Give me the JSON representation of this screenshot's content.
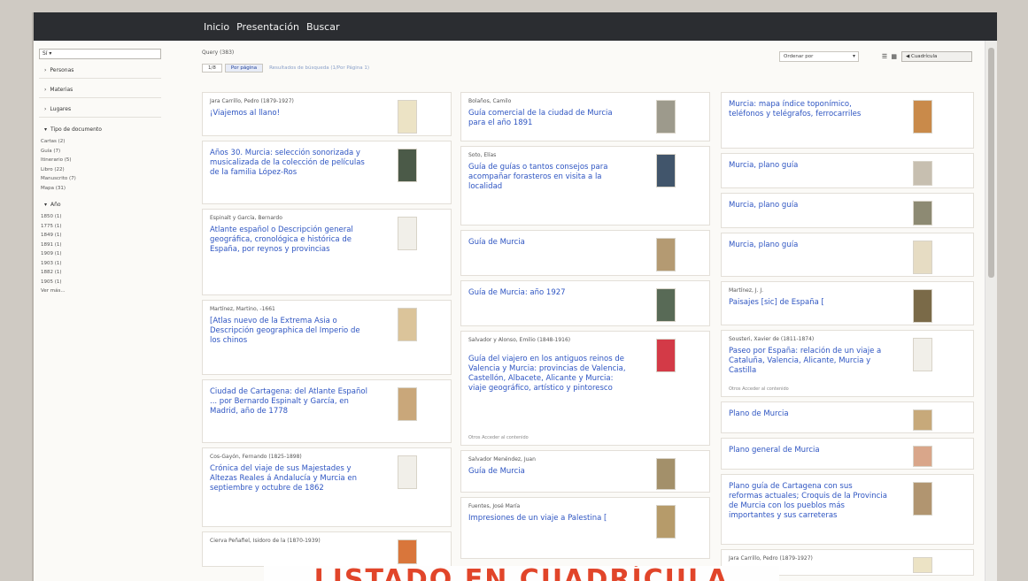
{
  "nav": {
    "items": [
      "Inicio",
      "Presentación",
      "Buscar"
    ]
  },
  "sidebar": {
    "select_value": "Sí ▾",
    "facets": [
      {
        "label": "Personas"
      },
      {
        "label": "Materias"
      },
      {
        "label": "Lugares"
      },
      {
        "label": "Tipo de documento",
        "items": [
          "Cartas (2)",
          "Guía (7)",
          "Itinerario (5)",
          "Libro (22)",
          "Manuscrito (7)",
          "Mapa (31)"
        ]
      },
      {
        "label": "Año",
        "items": [
          "1850 (1)",
          "1775 (1)",
          "1849 (1)",
          "1891 (1)",
          "1909 (1)",
          "1903 (1)",
          "1882 (1)",
          "1905 (1)",
          "Ver más..."
        ]
      }
    ]
  },
  "toolbar": {
    "query": "Query (383)",
    "pages": [
      "1/8",
      "Por página"
    ],
    "page_hint": "Resultados de búsqueda (1/Por Página 1)",
    "sort_label": "Ordenar por",
    "view_icons": "☰ ▦",
    "view_button": "◀ Cuadrícula"
  },
  "columns": [
    [
      {
        "author": "Jara Carrillo, Pedro (1879-1927)",
        "title": "¡Viajemos al llano!",
        "thumb": "#ece3c5",
        "h": 50
      },
      {
        "author": "",
        "title": "Años 30. Murcia: selección sonorizada y musicalizada de la colección de películas de la familia López-Ros",
        "thumb": "#4b5a48",
        "h": 72
      },
      {
        "author": "Espinalt y García, Bernardo",
        "title": "Atlante español o Descripción general geográfica, cronológica e histórica de España, por reynos y provincias",
        "thumb": "#f1efe9",
        "h": 98
      },
      {
        "author": "Martínez, Martino, -1661",
        "title": "[Atlas nuevo de la Extrema Asia o Descripción geographica del Imperio de los chinos",
        "thumb": "#dbc49a",
        "h": 85
      },
      {
        "author": "",
        "title": "Ciudad de Cartagena: del Atlante Español ... por Bernardo Espinalt y García, en Madrid, año de 1778",
        "thumb": "#c9a77a",
        "h": 72
      },
      {
        "author": "Cos-Gayón, Fernando (1825-1898)",
        "title": "Crónica del viaje de sus Majestades y Altezas Reales á Andalucía y Murcia en septiembre y octubre de 1862",
        "thumb": "#f1efe9",
        "h": 90
      },
      {
        "author": "Cierva Peñafiel, Isidoro de la (1870-1939)",
        "title": "",
        "thumb": "#d9763b",
        "h": 40
      }
    ],
    [
      {
        "author": "Bolaños, Camilo",
        "title": "Guía comercial de la ciudad de Murcia para el año 1891",
        "thumb": "#9d9a8c",
        "h": 56
      },
      {
        "author": "Soto, Elías",
        "title": "Guía de guías o tantos consejos para acompañar forasteros en visita a la localidad",
        "thumb": "#41556b",
        "h": 90
      },
      {
        "author": "",
        "title": "Guía de Murcia",
        "thumb": "#b49a72",
        "h": 52
      },
      {
        "author": "",
        "title": "Guía de Murcia: año 1927",
        "thumb": "#586a56",
        "h": 52
      },
      {
        "author": "Salvador y Alonso, Emilio (1848-1916)",
        "title": "Guía del viajero en los antiguos reinos de Valencia y Murcia: provincias de Valencia, Castellón, Albacete, Alicante y Murcia: viaje geográfico, artístico y pintoresco",
        "thumb": "#d33a47",
        "h": 130,
        "extra": "Otros Acceder al contenido"
      },
      {
        "author": "Salvador Menéndez, Juan",
        "title": "Guía de Murcia",
        "thumb": "#a3906a",
        "h": 48
      },
      {
        "author": "Fuentes, José María",
        "title": "Impresiones de un viaje a Palestina [",
        "thumb": "#b69b6a",
        "h": 70
      }
    ],
    [
      {
        "author": "",
        "title": "Murcia: mapa índice toponímico, teléfonos y telégrafos, ferrocarriles",
        "thumb": "#c98a4a",
        "h": 64
      },
      {
        "author": "",
        "title": "Murcia, plano guía",
        "thumb": "#c7bfb0",
        "h": 40
      },
      {
        "author": "",
        "title": "Murcia, plano guía",
        "thumb": "#8d8a73",
        "h": 40
      },
      {
        "author": "",
        "title": "Murcia, plano guía",
        "thumb": "#e6dcc3",
        "h": 50
      },
      {
        "author": "Martínez, J. J.",
        "title": "Paisajes [sic] de España [",
        "thumb": "#7a6a48",
        "h": 50
      },
      {
        "author": "Sousteri, Xavier de (1811-1874)",
        "title": "Paseo por España: relación de un viaje a Cataluña, Valencia, Alicante, Murcia y Castilla",
        "thumb": "#f1efe9",
        "h": 76,
        "extra": "Otros Acceder al contenido"
      },
      {
        "author": "",
        "title": "Plano de Murcia",
        "thumb": "#c7a97a",
        "h": 36
      },
      {
        "author": "",
        "title": "Plano general de Murcia",
        "thumb": "#d9a68a",
        "h": 36
      },
      {
        "author": "",
        "title": "Plano guía de Cartagena con sus reformas actuales; Croquis de la Provincia de Murcia con los pueblos más importantes y sus carreteras",
        "thumb": "#b19570",
        "h": 80
      },
      {
        "author": "Jara Carrillo, Pedro (1879-1927)",
        "title": "",
        "thumb": "#ece3c5",
        "h": 30
      }
    ]
  ],
  "banner": "LISTADO EN CUADRÍCULA"
}
